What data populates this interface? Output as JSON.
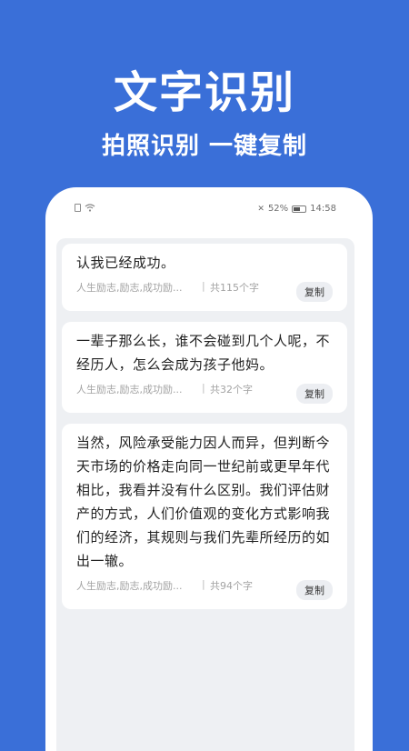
{
  "headline": "文字识别",
  "subheadline": "拍照识别 一键复制",
  "status_bar": {
    "battery_percent": "52%",
    "time": "14:58"
  },
  "cards": [
    {
      "text": "认我已经成功。",
      "tags": "人生励志,励志,成功励...",
      "separator": "|",
      "count": "共115个字",
      "copy_label": "复制"
    },
    {
      "text": "一辈子那么长，谁不会碰到几个人呢，不经历人，怎么会成为孩子他妈。",
      "tags": "人生励志,励志,成功励...",
      "separator": "|",
      "count": "共32个字",
      "copy_label": "复制"
    },
    {
      "text": "当然，风险承受能力因人而异，但判断今天市场的价格走向同一世纪前或更早年代相比，我看并没有什么区别。我们评估财产的方式，人们价值观的变化方式影响我们的经济，其规则与我们先辈所经历的如出一辙。",
      "tags": "人生励志,励志,成功励...",
      "separator": "|",
      "count": "共94个字",
      "copy_label": "复制"
    }
  ],
  "icons": {
    "sim": "sim-card-icon",
    "wifi": "wifi-icon",
    "mute": "mute-icon",
    "battery": "battery-icon"
  }
}
